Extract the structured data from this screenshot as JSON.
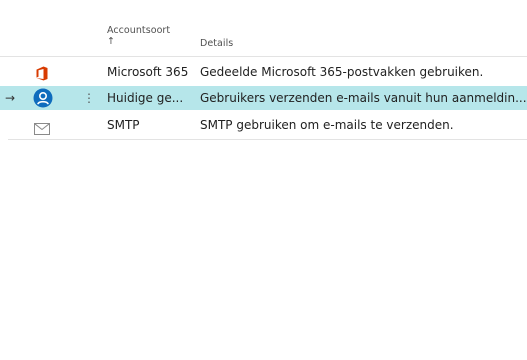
{
  "header": {
    "col_type_label": "Accountsoort",
    "col_type_sort_indicator": "↑",
    "col_details_label": "Details"
  },
  "rows": [
    {
      "icon": "microsoft-office-icon",
      "type": "Microsoft 365",
      "details": "Gedeelde Microsoft 365-postvakken gebruiken.",
      "selected": false
    },
    {
      "icon": "user-circle-icon",
      "type": "Huidige ge...",
      "details": "Gebruikers verzenden e-mails vanuit hun aanmeldin...",
      "selected": true,
      "row_marker": "→",
      "actions_icon": "⋮"
    },
    {
      "icon": "envelope-icon",
      "type": "SMTP",
      "details": "SMTP gebruiken om e-mails te verzenden.",
      "selected": false
    }
  ],
  "colors": {
    "selected_row_bg": "#b6e6ea",
    "office_red": "#d83b01",
    "user_blue": "#0f6cbd",
    "envelope_gray": "#8a8a8a"
  }
}
